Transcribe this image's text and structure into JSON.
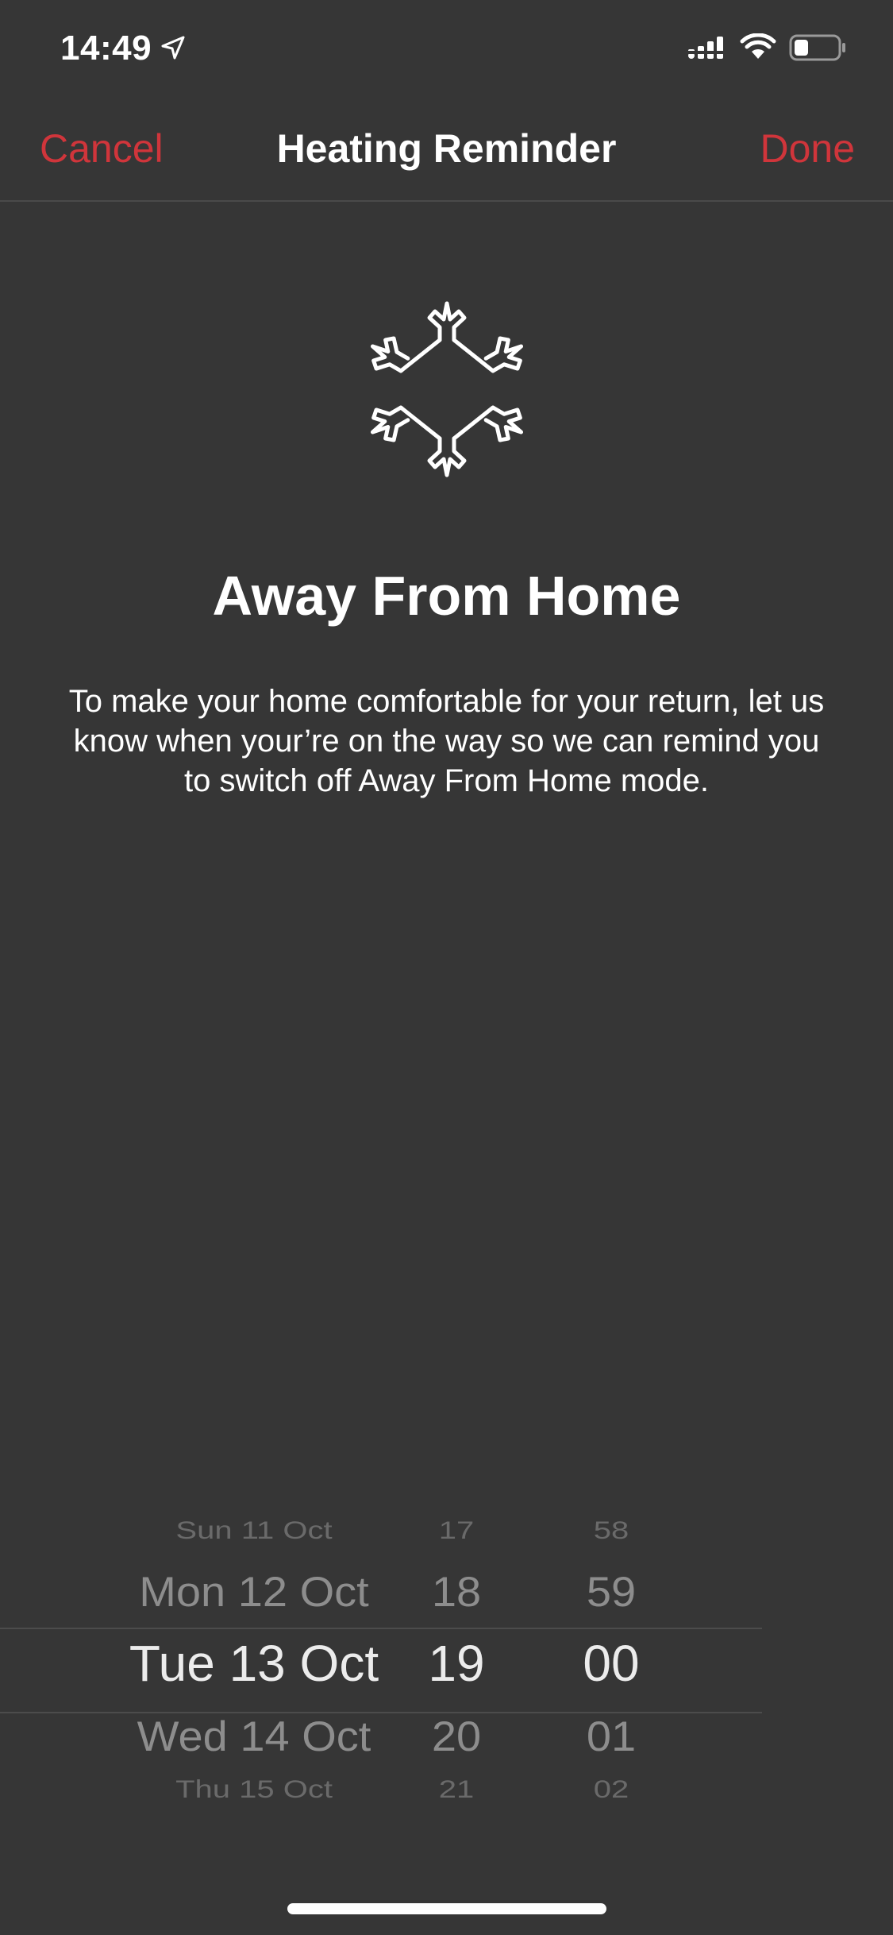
{
  "status_bar": {
    "time": "14:49",
    "icons": [
      "location-arrow-icon",
      "cellular-signal-icon",
      "wifi-icon",
      "battery-icon"
    ]
  },
  "nav": {
    "cancel_label": "Cancel",
    "title": "Heating Reminder",
    "done_label": "Done",
    "accent_color": "#d0353b"
  },
  "main": {
    "icon": "snowflake-icon",
    "heading": "Away From Home",
    "description": "To make your home comfortable for your return, let us know when your’re on the way so we can remind you to switch off Away From Home mode."
  },
  "picker": {
    "dates": [
      "Sun 11 Oct",
      "Mon 12 Oct",
      "Tue 13 Oct",
      "Wed 14 Oct",
      "Thu 15 Oct"
    ],
    "hours": [
      "17",
      "18",
      "19",
      "20",
      "21"
    ],
    "minutes": [
      "58",
      "59",
      "00",
      "01",
      "02"
    ],
    "selected": {
      "date": "Tue 13 Oct",
      "hour": "19",
      "minute": "00"
    }
  },
  "colors": {
    "background": "#363636",
    "accent": "#d0353b",
    "text": "#ffffff"
  }
}
